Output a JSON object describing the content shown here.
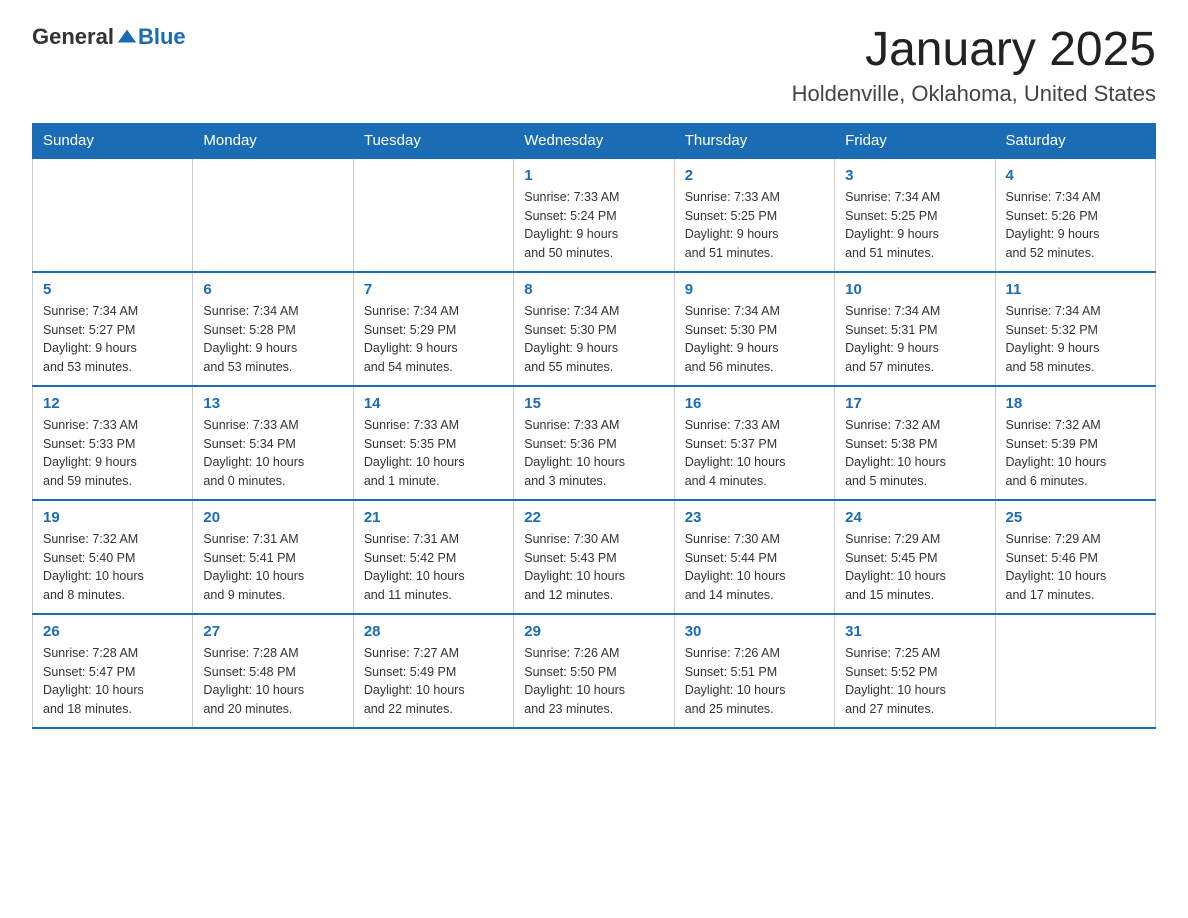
{
  "header": {
    "logo_general": "General",
    "logo_blue": "Blue",
    "title": "January 2025",
    "subtitle": "Holdenville, Oklahoma, United States"
  },
  "columns": [
    "Sunday",
    "Monday",
    "Tuesday",
    "Wednesday",
    "Thursday",
    "Friday",
    "Saturday"
  ],
  "weeks": [
    [
      {
        "day": "",
        "info": ""
      },
      {
        "day": "",
        "info": ""
      },
      {
        "day": "",
        "info": ""
      },
      {
        "day": "1",
        "info": "Sunrise: 7:33 AM\nSunset: 5:24 PM\nDaylight: 9 hours\nand 50 minutes."
      },
      {
        "day": "2",
        "info": "Sunrise: 7:33 AM\nSunset: 5:25 PM\nDaylight: 9 hours\nand 51 minutes."
      },
      {
        "day": "3",
        "info": "Sunrise: 7:34 AM\nSunset: 5:25 PM\nDaylight: 9 hours\nand 51 minutes."
      },
      {
        "day": "4",
        "info": "Sunrise: 7:34 AM\nSunset: 5:26 PM\nDaylight: 9 hours\nand 52 minutes."
      }
    ],
    [
      {
        "day": "5",
        "info": "Sunrise: 7:34 AM\nSunset: 5:27 PM\nDaylight: 9 hours\nand 53 minutes."
      },
      {
        "day": "6",
        "info": "Sunrise: 7:34 AM\nSunset: 5:28 PM\nDaylight: 9 hours\nand 53 minutes."
      },
      {
        "day": "7",
        "info": "Sunrise: 7:34 AM\nSunset: 5:29 PM\nDaylight: 9 hours\nand 54 minutes."
      },
      {
        "day": "8",
        "info": "Sunrise: 7:34 AM\nSunset: 5:30 PM\nDaylight: 9 hours\nand 55 minutes."
      },
      {
        "day": "9",
        "info": "Sunrise: 7:34 AM\nSunset: 5:30 PM\nDaylight: 9 hours\nand 56 minutes."
      },
      {
        "day": "10",
        "info": "Sunrise: 7:34 AM\nSunset: 5:31 PM\nDaylight: 9 hours\nand 57 minutes."
      },
      {
        "day": "11",
        "info": "Sunrise: 7:34 AM\nSunset: 5:32 PM\nDaylight: 9 hours\nand 58 minutes."
      }
    ],
    [
      {
        "day": "12",
        "info": "Sunrise: 7:33 AM\nSunset: 5:33 PM\nDaylight: 9 hours\nand 59 minutes."
      },
      {
        "day": "13",
        "info": "Sunrise: 7:33 AM\nSunset: 5:34 PM\nDaylight: 10 hours\nand 0 minutes."
      },
      {
        "day": "14",
        "info": "Sunrise: 7:33 AM\nSunset: 5:35 PM\nDaylight: 10 hours\nand 1 minute."
      },
      {
        "day": "15",
        "info": "Sunrise: 7:33 AM\nSunset: 5:36 PM\nDaylight: 10 hours\nand 3 minutes."
      },
      {
        "day": "16",
        "info": "Sunrise: 7:33 AM\nSunset: 5:37 PM\nDaylight: 10 hours\nand 4 minutes."
      },
      {
        "day": "17",
        "info": "Sunrise: 7:32 AM\nSunset: 5:38 PM\nDaylight: 10 hours\nand 5 minutes."
      },
      {
        "day": "18",
        "info": "Sunrise: 7:32 AM\nSunset: 5:39 PM\nDaylight: 10 hours\nand 6 minutes."
      }
    ],
    [
      {
        "day": "19",
        "info": "Sunrise: 7:32 AM\nSunset: 5:40 PM\nDaylight: 10 hours\nand 8 minutes."
      },
      {
        "day": "20",
        "info": "Sunrise: 7:31 AM\nSunset: 5:41 PM\nDaylight: 10 hours\nand 9 minutes."
      },
      {
        "day": "21",
        "info": "Sunrise: 7:31 AM\nSunset: 5:42 PM\nDaylight: 10 hours\nand 11 minutes."
      },
      {
        "day": "22",
        "info": "Sunrise: 7:30 AM\nSunset: 5:43 PM\nDaylight: 10 hours\nand 12 minutes."
      },
      {
        "day": "23",
        "info": "Sunrise: 7:30 AM\nSunset: 5:44 PM\nDaylight: 10 hours\nand 14 minutes."
      },
      {
        "day": "24",
        "info": "Sunrise: 7:29 AM\nSunset: 5:45 PM\nDaylight: 10 hours\nand 15 minutes."
      },
      {
        "day": "25",
        "info": "Sunrise: 7:29 AM\nSunset: 5:46 PM\nDaylight: 10 hours\nand 17 minutes."
      }
    ],
    [
      {
        "day": "26",
        "info": "Sunrise: 7:28 AM\nSunset: 5:47 PM\nDaylight: 10 hours\nand 18 minutes."
      },
      {
        "day": "27",
        "info": "Sunrise: 7:28 AM\nSunset: 5:48 PM\nDaylight: 10 hours\nand 20 minutes."
      },
      {
        "day": "28",
        "info": "Sunrise: 7:27 AM\nSunset: 5:49 PM\nDaylight: 10 hours\nand 22 minutes."
      },
      {
        "day": "29",
        "info": "Sunrise: 7:26 AM\nSunset: 5:50 PM\nDaylight: 10 hours\nand 23 minutes."
      },
      {
        "day": "30",
        "info": "Sunrise: 7:26 AM\nSunset: 5:51 PM\nDaylight: 10 hours\nand 25 minutes."
      },
      {
        "day": "31",
        "info": "Sunrise: 7:25 AM\nSunset: 5:52 PM\nDaylight: 10 hours\nand 27 minutes."
      },
      {
        "day": "",
        "info": ""
      }
    ]
  ]
}
